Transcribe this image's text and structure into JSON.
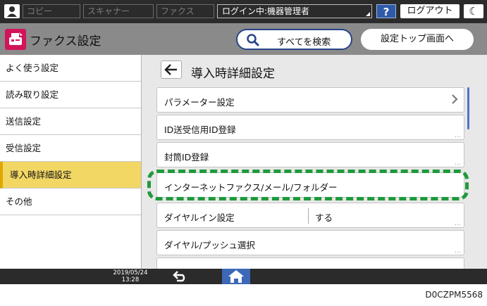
{
  "topbar": {
    "tabs": [
      "コピー",
      "スキャナー",
      "ファクス"
    ],
    "login_status": "ログイン中:機器管理者",
    "help_label": "?",
    "logout_label": "ログアウト",
    "energy_label": "☾"
  },
  "header": {
    "app_title": "ファクス設定",
    "search_label": "すべてを検索",
    "settings_top_label": "設定トップ画面へ"
  },
  "sidebar": {
    "items": [
      {
        "label": "よく使う設定"
      },
      {
        "label": "読み取り設定"
      },
      {
        "label": "送信設定"
      },
      {
        "label": "受信設定"
      },
      {
        "label": "導入時詳細設定"
      },
      {
        "label": "その他"
      }
    ],
    "active_index": 4
  },
  "main": {
    "page_title": "導入時詳細設定",
    "rows": [
      {
        "label": "パラメーター設定"
      },
      {
        "label": "ID送受信用ID登録"
      },
      {
        "label": "封筒ID登録"
      },
      {
        "label": "インターネットファクス/メール/フォルダー"
      },
      {
        "label": "ダイヤルイン設定",
        "value": "する"
      },
      {
        "label": "ダイヤル/プッシュ選択"
      }
    ]
  },
  "footer": {
    "date": "2019/05/24",
    "time": "13:28"
  },
  "document_id": "D0CZPM5568",
  "colors": {
    "active_item": "#f2d765",
    "highlight": "#1f9a3c",
    "home_button": "#3d68b8",
    "fax_icon": "#d2145a"
  }
}
